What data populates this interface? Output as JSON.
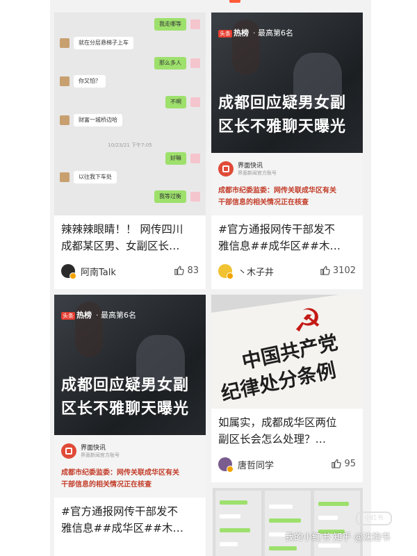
{
  "cards": [
    {
      "title_lines": [
        "辣辣辣眼睛！！ 网传四川",
        "成都某区男、女副区长…"
      ],
      "author": "阿南Talk",
      "likes": "83",
      "chat": {
        "messages": [
          {
            "side": "r",
            "text": "我走哪等"
          },
          {
            "side": "l",
            "text": "就在分层悬梯子上车"
          },
          {
            "side": "r",
            "text": "那么多人"
          },
          {
            "side": "l",
            "text": "你又怕？"
          },
          {
            "side": "r",
            "text": "不啊"
          },
          {
            "side": "l",
            "text": "财富一城桥边哈"
          },
          {
            "side": "r",
            "text": "好嘛"
          },
          {
            "side": "l",
            "text": "以往我下车处"
          },
          {
            "side": "r",
            "text": "我等过衡"
          }
        ],
        "time": "10/23/21 下午7:05"
      }
    },
    {
      "title_lines": [
        "#官方通报网传干部发不",
        "雅信息##成华区##木…"
      ],
      "author": "丶木子井",
      "likes": "3102",
      "news": {
        "tag": "头条",
        "rank_label": "热榜",
        "rank_sub": "· 最高第6名",
        "headline_lines": [
          "成都回应疑男女副",
          "区长不雅聊天曝光"
        ],
        "source": "界面快讯",
        "source_sub": "界面新闻官方账号",
        "body_lines": [
          "成都市纪委监委：网传关联成华区有关",
          "干部信息的相关情况正在核查"
        ]
      }
    },
    {
      "title_lines": [
        "#官方通报网传干部发不",
        "雅信息##成华区##木…"
      ],
      "author": "",
      "likes": "",
      "news": {
        "tag": "头条",
        "rank_label": "热榜",
        "rank_sub": "· 最高第6名",
        "headline_lines": [
          "成都回应疑男女副",
          "区长不雅聊天曝光"
        ],
        "source": "界面快讯",
        "source_sub": "界面新闻官方账号",
        "body_lines": [
          "成都市纪委监委：网传关联成华区有关",
          "干部信息的相关情况正在核查"
        ]
      }
    },
    {
      "title_lines": [
        "如属实，成都成华区两位",
        "副区长会怎么处理？…"
      ],
      "author": "唐哲同学",
      "likes": "95",
      "party": {
        "emblem": "☭",
        "lines": [
          "中国共产党",
          "纪律处分条例"
        ]
      }
    }
  ],
  "watermark": "我的小红书 知乎 @沈抱书",
  "badge": "小红书",
  "colors": {
    "accent": "#ff5b37",
    "wechat_green": "#9de06c",
    "news_red": "#c33d2a"
  }
}
